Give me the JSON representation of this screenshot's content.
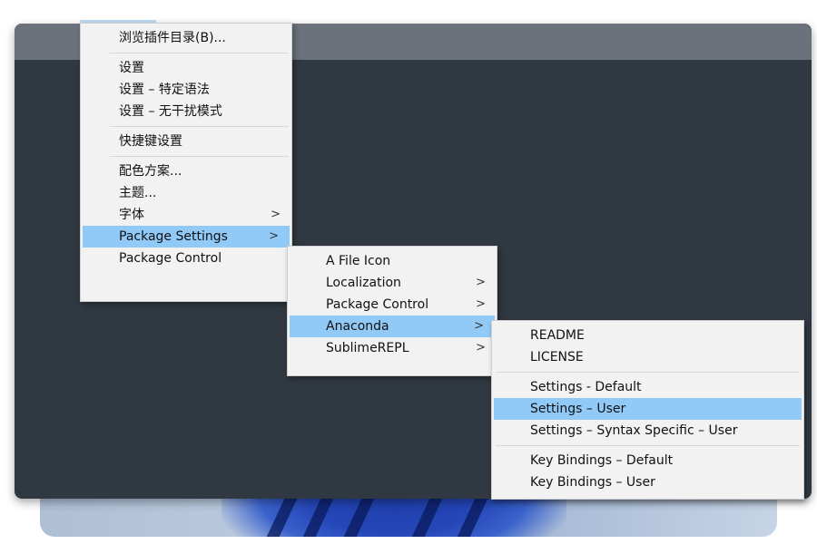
{
  "main_menu": {
    "items": [
      {
        "label": "浏览插件目录(B)...",
        "separator_after": true
      },
      {
        "label": "设置"
      },
      {
        "label": "设置 – 特定语法"
      },
      {
        "label": "设置 – 无干扰模式",
        "separator_after": true
      },
      {
        "label": "快捷键设置",
        "separator_after": true
      },
      {
        "label": "配色方案..."
      },
      {
        "label": "主题..."
      },
      {
        "label": "字体",
        "submenu_arrow": ">"
      },
      {
        "label": "Package Settings",
        "submenu_arrow": ">",
        "highlighted": true
      },
      {
        "label": "Package Control"
      }
    ]
  },
  "package_settings_menu": {
    "items": [
      {
        "label": "A File Icon"
      },
      {
        "label": "Localization",
        "submenu_arrow": ">"
      },
      {
        "label": "Package Control",
        "submenu_arrow": ">"
      },
      {
        "label": "Anaconda",
        "submenu_arrow": ">",
        "highlighted": true
      },
      {
        "label": "SublimeREPL",
        "submenu_arrow": ">"
      }
    ]
  },
  "anaconda_menu": {
    "items": [
      {
        "label": "README"
      },
      {
        "label": "LICENSE",
        "separator_after": true
      },
      {
        "label": "Settings - Default"
      },
      {
        "label": "Settings – User",
        "highlighted": true
      },
      {
        "label": "Settings – Syntax Specific – User",
        "separator_after": true
      },
      {
        "label": "Key Bindings – Default"
      },
      {
        "label": "Key Bindings – User"
      }
    ]
  },
  "colors": {
    "highlight": "#91c9f7",
    "menu_background": "#f2f2f2",
    "editor_background": "#303841",
    "titlebar": "#6b727b"
  }
}
